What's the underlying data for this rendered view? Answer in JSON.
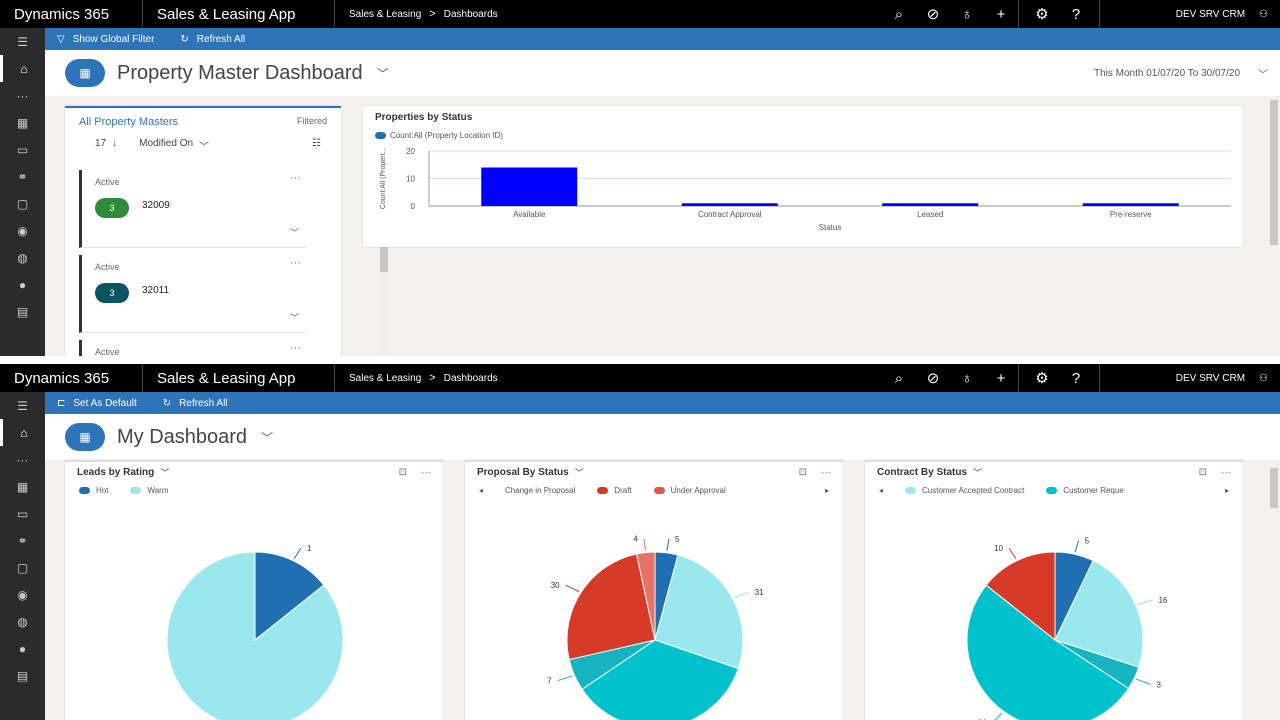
{
  "pane1": {
    "topbar": {
      "brand": "Dynamics 365",
      "app": "Sales & Leasing App",
      "crumb1": "Sales & Leasing",
      "crumb_sep": ">",
      "crumb2": "Dashboards",
      "user": "DEV SRV CRM"
    },
    "cmdbar": {
      "filter_label": "Show Global Filter",
      "refresh_label": "Refresh All"
    },
    "title": "Property Master Dashboard",
    "period": "This Month 01/07/20 To 30/07/20",
    "list": {
      "title": "All Property Masters",
      "filtered": "Filtered",
      "count": "17",
      "sort_field": "Modified On",
      "records": [
        {
          "status": "Active",
          "badge": "3",
          "number": "32009",
          "badge_color": "#2e8b3a"
        },
        {
          "status": "Active",
          "badge": "3",
          "number": "32011",
          "badge_color": "#0b5561"
        },
        {
          "status": "Active",
          "badge": "",
          "number": "",
          "badge_color": "#888888"
        }
      ]
    },
    "chart": {
      "title": "Properties by Status",
      "legend": "Count:All (Property Location ID)"
    }
  },
  "chart_data": {
    "type": "bar",
    "title": "Properties by Status",
    "categories": [
      "Available",
      "Contract Approval",
      "Leased",
      "Pre-reserve"
    ],
    "series": [
      {
        "name": "Count:All (Property Location ID)",
        "values": [
          14,
          1,
          1,
          1
        ]
      }
    ],
    "xlabel": "Status",
    "ylabel": "Count:All (Propert...",
    "ylim": [
      0,
      20
    ],
    "yticks": [
      "20",
      "10",
      "0"
    ],
    "bar_color": "#0000ff"
  },
  "pane2": {
    "topbar": {
      "brand": "Dynamics 365",
      "app": "Sales & Leasing App",
      "crumb1": "Sales & Leasing",
      "crumb_sep": ">",
      "crumb2": "Dashboards",
      "user": "DEV SRV CRM"
    },
    "cmdbar": {
      "default_label": "Set As Default",
      "refresh_label": "Refresh All"
    },
    "title": "My Dashboard",
    "pies": [
      {
        "title": "Leads by Rating",
        "legend": [
          {
            "label": "Hot",
            "color": "#1f6fb2"
          },
          {
            "label": "Warm",
            "color": "#9ae8ee"
          }
        ],
        "has_arrows": false,
        "slices": [
          {
            "label": "Hot",
            "value": 1,
            "text": "1",
            "color": "#1f6fb2"
          },
          {
            "label": "Warm",
            "value": 6,
            "text": "6",
            "color": "#9ae8ee"
          }
        ]
      },
      {
        "title": "Proposal By Status",
        "legend": [
          {
            "label": "Change in Proposal",
            "color": ""
          },
          {
            "label": "Draft",
            "color": "#d63a28"
          },
          {
            "label": "Under Approval",
            "color": "#e2584a"
          }
        ],
        "has_arrows": true,
        "slices": [
          {
            "label": "Change in Proposal",
            "value": 5,
            "text": "5",
            "color": "#1f6fb2"
          },
          {
            "label": "",
            "value": 31,
            "text": "31",
            "color": "#9ae8ee"
          },
          {
            "label": "",
            "value": 42,
            "text": "42",
            "color": "#00c2cc"
          },
          {
            "label": "",
            "value": 7,
            "text": "7",
            "color": "#17b3c0"
          },
          {
            "label": "Draft",
            "value": 30,
            "text": "30",
            "color": "#d63a28"
          },
          {
            "label": "Under Approval",
            "value": 4,
            "text": "4",
            "color": "#e57368"
          }
        ]
      },
      {
        "title": "Contract By Status",
        "legend": [
          {
            "label": "Customer Accepted Contract",
            "color": "#9ae8ee"
          },
          {
            "label": "Customer Reque",
            "color": "#00c2cc"
          }
        ],
        "has_arrows": true,
        "slices": [
          {
            "label": "",
            "value": 5,
            "text": "5",
            "color": "#1f6fb2"
          },
          {
            "label": "Customer Accepted Contract",
            "value": 16,
            "text": "16",
            "color": "#9ae8ee"
          },
          {
            "label": "",
            "value": 3,
            "text": "3",
            "color": "#17b3c0"
          },
          {
            "label": "Customer Reque",
            "value": 36,
            "text": "36",
            "color": "#00c2cc"
          },
          {
            "label": "",
            "value": 10,
            "text": "10",
            "color": "#d63a28"
          }
        ]
      }
    ]
  },
  "icons": {
    "search": "search-icon",
    "task": "task-icon",
    "lightbulb": "lightbulb-icon",
    "add": "add-icon",
    "settings": "gear-icon",
    "help": "help-icon",
    "user": "user-icon"
  }
}
